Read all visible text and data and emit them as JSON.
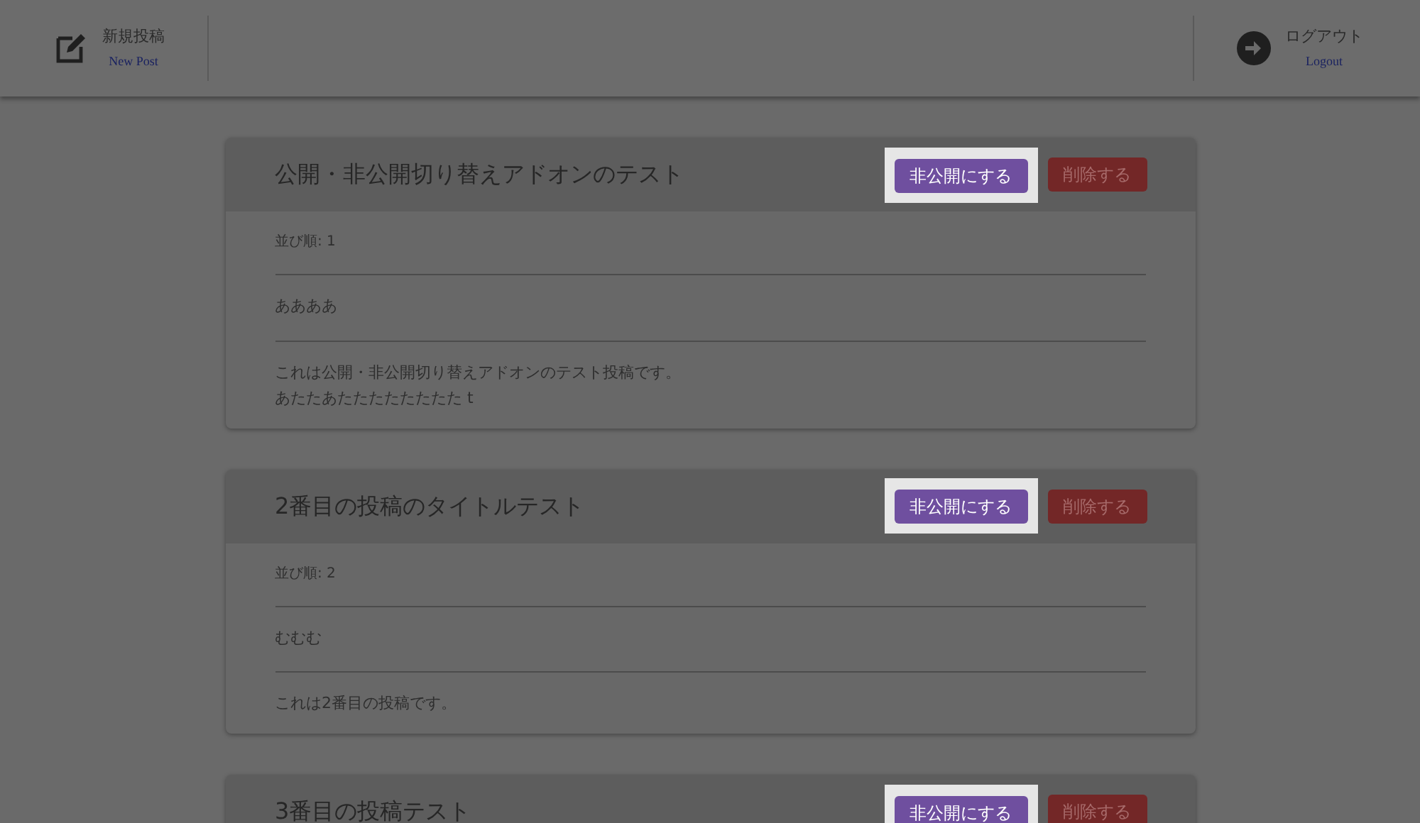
{
  "header": {
    "new_post": {
      "label": "新規投稿",
      "sublabel": "New Post"
    },
    "logout": {
      "label": "ログアウト",
      "sublabel": "Logout"
    }
  },
  "posts": [
    {
      "title": "公開・非公開切り替えアドオンのテスト",
      "toggle_button": {
        "label": "非公開にする",
        "highlighted": true
      },
      "delete_button": "削除する",
      "order": "並び順: 1",
      "subtitle": "ああああ",
      "body": [
        "これは公開・非公開切り替えアドオンのテスト投稿です。",
        "あたたあたたたたたたたた t"
      ]
    },
    {
      "title": "2番目の投稿のタイトルテスト",
      "toggle_button": {
        "label": "非公開にする",
        "highlighted": true
      },
      "delete_button": "削除する",
      "order": "並び順: 2",
      "subtitle": "むむむ",
      "body": [
        "これは2番目の投稿です。"
      ]
    },
    {
      "title": "3番目の投稿テスト",
      "toggle_button": {
        "label": "非公開にする",
        "highlighted": true
      },
      "delete_button": "削除する"
    }
  ]
}
